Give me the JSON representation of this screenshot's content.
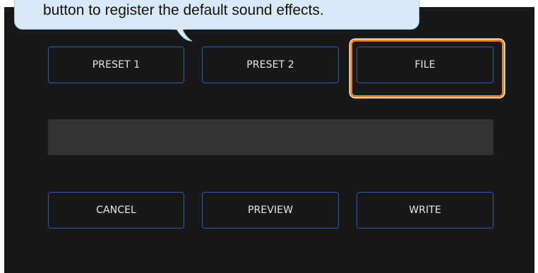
{
  "tooltip": {
    "text": "button to register the default sound effects."
  },
  "presets": {
    "preset1_label": "PRESET 1",
    "preset2_label": "PRESET 2",
    "file_label": "FILE"
  },
  "file_name_field": {
    "value": ""
  },
  "actions": {
    "cancel_label": "CANCEL",
    "preview_label": "PREVIEW",
    "write_label": "WRITE"
  },
  "colors": {
    "panel_background": "#181818",
    "button_border": "#2f5aa8",
    "highlight_border": "#f5821f",
    "tooltip_background": "#d8eaf9",
    "field_background": "#333333"
  }
}
